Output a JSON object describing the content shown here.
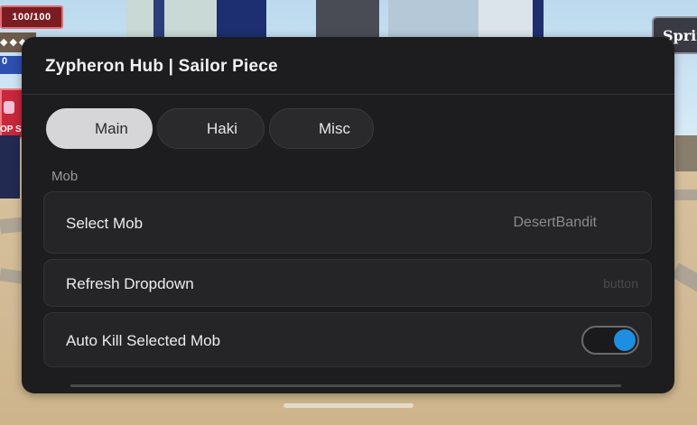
{
  "hud": {
    "hp": "100/100",
    "stat_fragment": "◆◆◆ C",
    "blue_fragment": "0",
    "op_fragment": "OP S",
    "spring_label": "Spring"
  },
  "hub": {
    "title": "Zypheron Hub | Sailor Piece",
    "tabs": [
      {
        "label": "Main",
        "active": true
      },
      {
        "label": "Haki",
        "active": false
      },
      {
        "label": "Misc",
        "active": false
      }
    ],
    "section": "Mob",
    "select_mob": {
      "label": "Select Mob",
      "value": "DesertBandit"
    },
    "refresh": {
      "label": "Refresh Dropdown",
      "hint": "button"
    },
    "auto_kill": {
      "label": "Auto Kill Selected Mob",
      "enabled": true
    }
  },
  "colors": {
    "panel_bg": "#1d1d1f",
    "row_bg": "#252527",
    "toggle_on": "#1d8fe0",
    "active_tab": "#d6d6d8"
  }
}
